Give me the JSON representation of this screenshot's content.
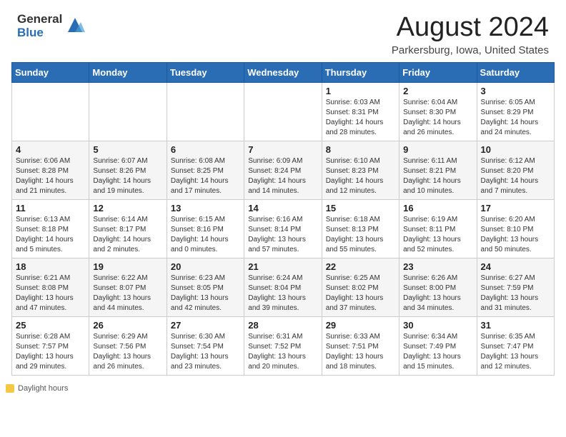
{
  "header": {
    "logo_general": "General",
    "logo_blue": "Blue",
    "month_year": "August 2024",
    "location": "Parkersburg, Iowa, United States"
  },
  "calendar": {
    "days_of_week": [
      "Sunday",
      "Monday",
      "Tuesday",
      "Wednesday",
      "Thursday",
      "Friday",
      "Saturday"
    ],
    "weeks": [
      [
        {
          "day": "",
          "info": ""
        },
        {
          "day": "",
          "info": ""
        },
        {
          "day": "",
          "info": ""
        },
        {
          "day": "",
          "info": ""
        },
        {
          "day": "1",
          "info": "Sunrise: 6:03 AM\nSunset: 8:31 PM\nDaylight: 14 hours and 28 minutes."
        },
        {
          "day": "2",
          "info": "Sunrise: 6:04 AM\nSunset: 8:30 PM\nDaylight: 14 hours and 26 minutes."
        },
        {
          "day": "3",
          "info": "Sunrise: 6:05 AM\nSunset: 8:29 PM\nDaylight: 14 hours and 24 minutes."
        }
      ],
      [
        {
          "day": "4",
          "info": "Sunrise: 6:06 AM\nSunset: 8:28 PM\nDaylight: 14 hours and 21 minutes."
        },
        {
          "day": "5",
          "info": "Sunrise: 6:07 AM\nSunset: 8:26 PM\nDaylight: 14 hours and 19 minutes."
        },
        {
          "day": "6",
          "info": "Sunrise: 6:08 AM\nSunset: 8:25 PM\nDaylight: 14 hours and 17 minutes."
        },
        {
          "day": "7",
          "info": "Sunrise: 6:09 AM\nSunset: 8:24 PM\nDaylight: 14 hours and 14 minutes."
        },
        {
          "day": "8",
          "info": "Sunrise: 6:10 AM\nSunset: 8:23 PM\nDaylight: 14 hours and 12 minutes."
        },
        {
          "day": "9",
          "info": "Sunrise: 6:11 AM\nSunset: 8:21 PM\nDaylight: 14 hours and 10 minutes."
        },
        {
          "day": "10",
          "info": "Sunrise: 6:12 AM\nSunset: 8:20 PM\nDaylight: 14 hours and 7 minutes."
        }
      ],
      [
        {
          "day": "11",
          "info": "Sunrise: 6:13 AM\nSunset: 8:18 PM\nDaylight: 14 hours and 5 minutes."
        },
        {
          "day": "12",
          "info": "Sunrise: 6:14 AM\nSunset: 8:17 PM\nDaylight: 14 hours and 2 minutes."
        },
        {
          "day": "13",
          "info": "Sunrise: 6:15 AM\nSunset: 8:16 PM\nDaylight: 14 hours and 0 minutes."
        },
        {
          "day": "14",
          "info": "Sunrise: 6:16 AM\nSunset: 8:14 PM\nDaylight: 13 hours and 57 minutes."
        },
        {
          "day": "15",
          "info": "Sunrise: 6:18 AM\nSunset: 8:13 PM\nDaylight: 13 hours and 55 minutes."
        },
        {
          "day": "16",
          "info": "Sunrise: 6:19 AM\nSunset: 8:11 PM\nDaylight: 13 hours and 52 minutes."
        },
        {
          "day": "17",
          "info": "Sunrise: 6:20 AM\nSunset: 8:10 PM\nDaylight: 13 hours and 50 minutes."
        }
      ],
      [
        {
          "day": "18",
          "info": "Sunrise: 6:21 AM\nSunset: 8:08 PM\nDaylight: 13 hours and 47 minutes."
        },
        {
          "day": "19",
          "info": "Sunrise: 6:22 AM\nSunset: 8:07 PM\nDaylight: 13 hours and 44 minutes."
        },
        {
          "day": "20",
          "info": "Sunrise: 6:23 AM\nSunset: 8:05 PM\nDaylight: 13 hours and 42 minutes."
        },
        {
          "day": "21",
          "info": "Sunrise: 6:24 AM\nSunset: 8:04 PM\nDaylight: 13 hours and 39 minutes."
        },
        {
          "day": "22",
          "info": "Sunrise: 6:25 AM\nSunset: 8:02 PM\nDaylight: 13 hours and 37 minutes."
        },
        {
          "day": "23",
          "info": "Sunrise: 6:26 AM\nSunset: 8:00 PM\nDaylight: 13 hours and 34 minutes."
        },
        {
          "day": "24",
          "info": "Sunrise: 6:27 AM\nSunset: 7:59 PM\nDaylight: 13 hours and 31 minutes."
        }
      ],
      [
        {
          "day": "25",
          "info": "Sunrise: 6:28 AM\nSunset: 7:57 PM\nDaylight: 13 hours and 29 minutes."
        },
        {
          "day": "26",
          "info": "Sunrise: 6:29 AM\nSunset: 7:56 PM\nDaylight: 13 hours and 26 minutes."
        },
        {
          "day": "27",
          "info": "Sunrise: 6:30 AM\nSunset: 7:54 PM\nDaylight: 13 hours and 23 minutes."
        },
        {
          "day": "28",
          "info": "Sunrise: 6:31 AM\nSunset: 7:52 PM\nDaylight: 13 hours and 20 minutes."
        },
        {
          "day": "29",
          "info": "Sunrise: 6:33 AM\nSunset: 7:51 PM\nDaylight: 13 hours and 18 minutes."
        },
        {
          "day": "30",
          "info": "Sunrise: 6:34 AM\nSunset: 7:49 PM\nDaylight: 13 hours and 15 minutes."
        },
        {
          "day": "31",
          "info": "Sunrise: 6:35 AM\nSunset: 7:47 PM\nDaylight: 13 hours and 12 minutes."
        }
      ]
    ]
  },
  "footer": {
    "daylight_hours_label": "Daylight hours"
  }
}
